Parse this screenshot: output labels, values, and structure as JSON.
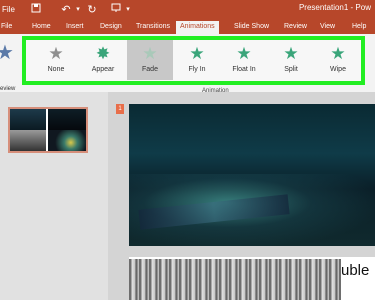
{
  "titlebar": {
    "file_label": "File",
    "document_title": "Presentation1 - Pow",
    "icons": [
      "save-icon",
      "undo-icon",
      "redo-icon",
      "present-icon"
    ]
  },
  "tabs": [
    {
      "label": "Home"
    },
    {
      "label": "Insert"
    },
    {
      "label": "Design"
    },
    {
      "label": "Transitions"
    },
    {
      "label": "Animations",
      "active": true
    },
    {
      "label": "Slide Show"
    },
    {
      "label": "Review"
    },
    {
      "label": "View"
    },
    {
      "label": "Help"
    }
  ],
  "ribbon": {
    "preview_label": "review",
    "group_label": "Animation",
    "animations": [
      {
        "label": "None",
        "icon": "star-gray-icon"
      },
      {
        "label": "Appear",
        "icon": "star-burst-green-icon"
      },
      {
        "label": "Fade",
        "icon": "star-fade-icon",
        "selected": true
      },
      {
        "label": "Fly In",
        "icon": "star-fly-in-icon"
      },
      {
        "label": "Float In",
        "icon": "star-float-in-icon"
      },
      {
        "label": "Split",
        "icon": "star-split-icon"
      },
      {
        "label": "Wipe",
        "icon": "star-wipe-icon"
      }
    ]
  },
  "slides": {
    "current_number": "1",
    "slide2_text": "uble"
  },
  "colors": {
    "accent": "#b7472a",
    "highlight_box": "#22ee22",
    "star_green": "#3aa57a"
  }
}
